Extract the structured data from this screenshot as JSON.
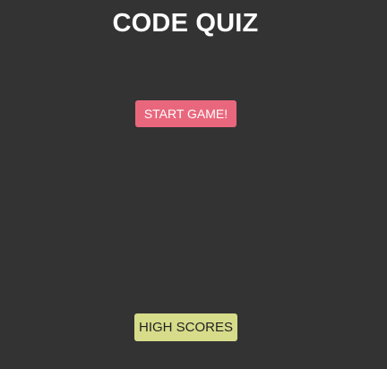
{
  "header": {
    "title": "CODE QUIZ"
  },
  "main": {
    "start_label": "START GAME!",
    "high_scores_label": "HIGH SCORES"
  },
  "colors": {
    "background": "#333333",
    "start_button": "#e9677d",
    "high_scores_button": "#d7dc8a",
    "title_text": "#ffffff"
  }
}
